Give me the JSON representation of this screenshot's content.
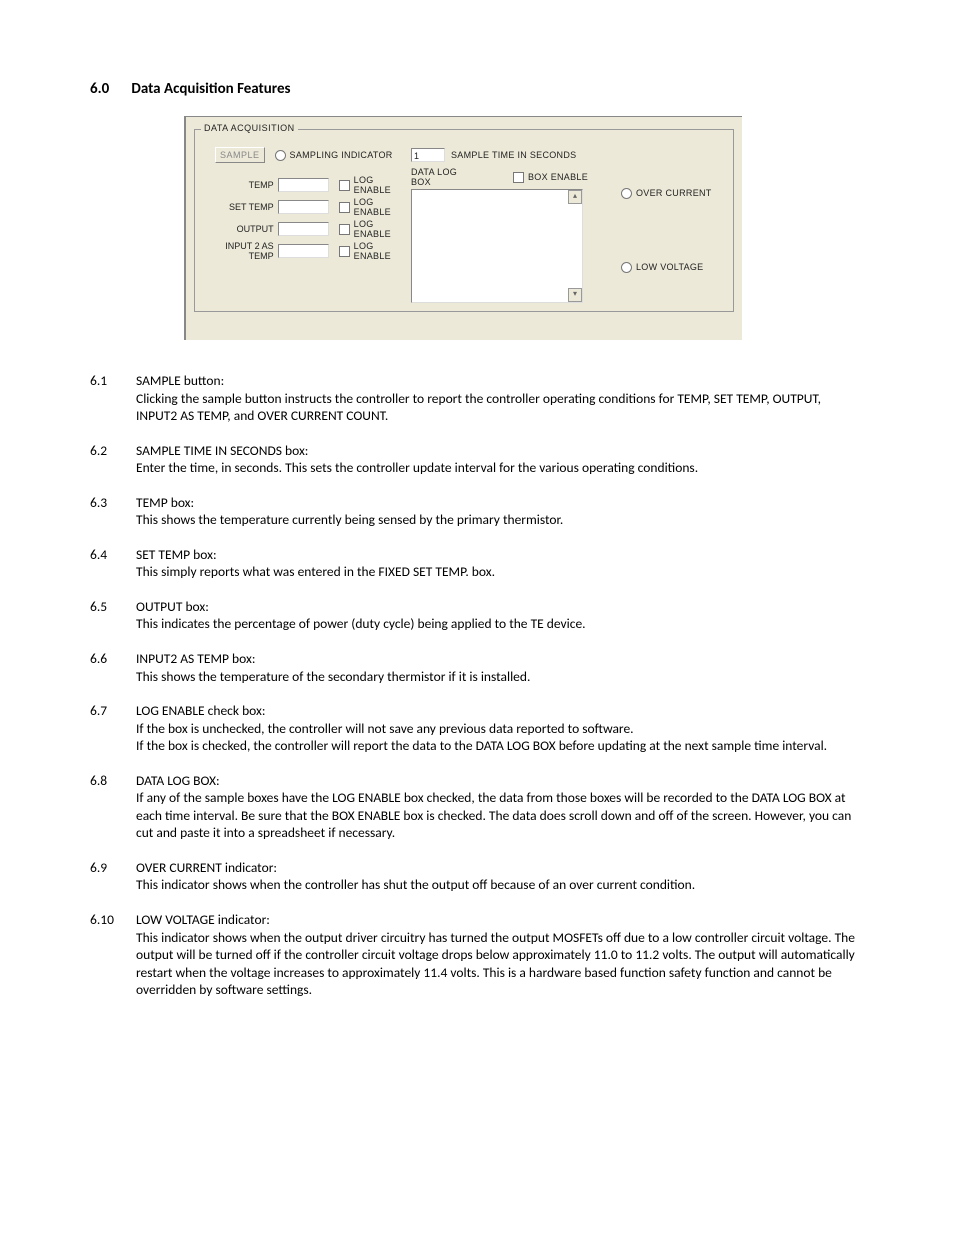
{
  "heading": {
    "num": "6.0",
    "title": "Data Acquisition Features"
  },
  "panel": {
    "legend": "DATA ACQUISITION",
    "sampleBtn": "SAMPLE",
    "samplingIndicator": "SAMPLING INDICATOR",
    "sampleTimeValue": "1",
    "sampleTimeLabel": "SAMPLE TIME IN SECONDS",
    "dataLogBoxLabel": "DATA LOG BOX",
    "boxEnable": "BOX ENABLE",
    "rows": [
      {
        "label": "TEMP",
        "log": "LOG ENABLE"
      },
      {
        "label": "SET TEMP",
        "log": "LOG ENABLE"
      },
      {
        "label": "OUTPUT",
        "log": "LOG ENABLE"
      },
      {
        "label": "INPUT 2 AS TEMP",
        "log": "LOG ENABLE"
      }
    ],
    "overCurrent": "OVER CURRENT",
    "lowVoltage": "LOW VOLTAGE"
  },
  "items": [
    {
      "num": "6.1",
      "title": "SAMPLE button:",
      "body": "Clicking the sample button instructs the controller to report the controller operating conditions for TEMP, SET TEMP, OUTPUT, INPUT2 AS TEMP, and OVER CURRENT COUNT."
    },
    {
      "num": "6.2",
      "title": "SAMPLE TIME IN SECONDS box:",
      "body": "Enter the time, in seconds. This sets the controller update interval for the various operating conditions."
    },
    {
      "num": "6.3",
      "title": "TEMP box:",
      "body": "This shows the temperature currently being sensed by the primary thermistor."
    },
    {
      "num": "6.4",
      "title": "SET TEMP box:",
      "body": "This simply reports what was entered in the FIXED SET TEMP. box."
    },
    {
      "num": "6.5",
      "title": "OUTPUT box:",
      "body": "This indicates the percentage of power (duty cycle) being applied to the TE device."
    },
    {
      "num": "6.6",
      "title": "INPUT2 AS TEMP box:",
      "body": "This shows the temperature of the secondary thermistor if it is installed."
    },
    {
      "num": "6.7",
      "title": "LOG ENABLE check box:",
      "body": " If the box is unchecked, the controller will not save any previous data reported to software.\nIf the box is checked, the controller will report the data to the DATA LOG BOX before updating at the next sample time interval."
    },
    {
      "num": "6.8",
      "title": "DATA LOG BOX:",
      "body": "If any of the sample boxes have the LOG ENABLE box checked, the data from those boxes will be recorded to the DATA LOG BOX at each time interval. Be sure that the BOX ENABLE box is checked.  The data does scroll down and off of the screen.  However, you can cut and paste it into a spreadsheet if necessary."
    },
    {
      "num": "6.9",
      "title": "OVER CURRENT indicator:",
      "body": "This indicator shows when the controller has shut the output off because of an over current condition."
    },
    {
      "num": "6.10",
      "title": "LOW VOLTAGE indicator:",
      "body": "This indicator shows when the output driver circuitry has turned the output MOSFETs off due to a low controller circuit voltage.  The output will be turned off if the controller circuit voltage drops below approximately 11.0 to 11.2 volts.  The output will automatically restart when the voltage increases to approximately 11.4 volts. This is a hardware based function safety function and cannot be overridden by software settings."
    }
  ]
}
